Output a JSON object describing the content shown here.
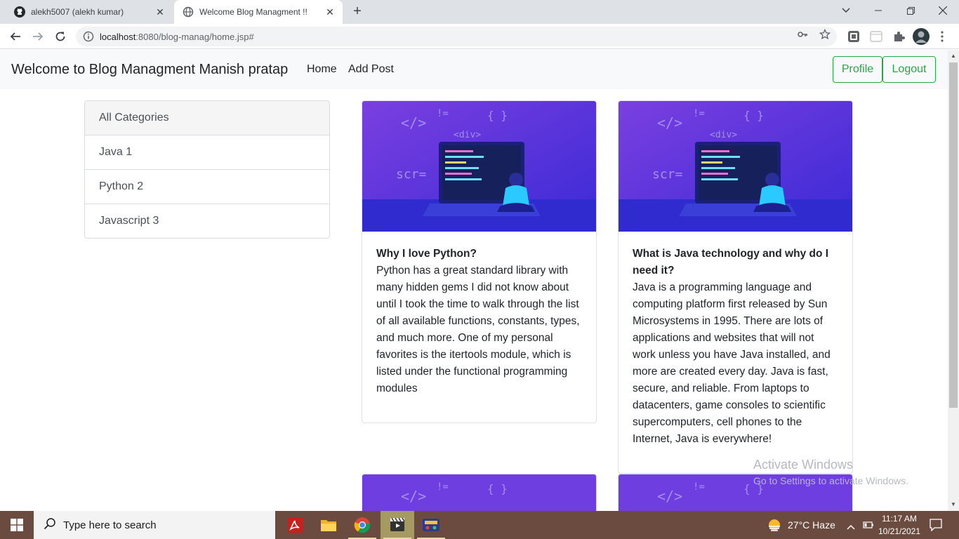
{
  "browser": {
    "tabs": [
      {
        "title": "alekh5007 (alekh kumar)",
        "active": false,
        "icon": "github-icon"
      },
      {
        "title": "Welcome Blog Managment !!",
        "active": true,
        "icon": "globe-icon"
      }
    ],
    "new_tab_label": "+",
    "url_host": "localhost",
    "url_path": ":8080/blog-manag/home.jsp#",
    "colors": {
      "tabstrip": "#dee1e6",
      "omnibox": "#f1f3f4"
    }
  },
  "page": {
    "brand": "Welcome to Blog Managment Manish pratap",
    "nav_links": [
      "Home",
      "Add Post"
    ],
    "profile_button": "Profile",
    "logout_button": "Logout",
    "categories": [
      "All Categories",
      "Java 1",
      "Python 2",
      "Javascript 3"
    ],
    "posts": [
      {
        "title": "Why I love Python?",
        "content": "Python has a great standard library with many hidden gems I did not know about until I took the time to walk through the list of all available functions, constants, types, and much more. One of my personal favorites is the itertools module, which is listed under the functional programming modules"
      },
      {
        "title": "What is Java technology and why do I need it?",
        "content": "Java is a programming language and computing platform first released by Sun Microsystems in 1995. There are lots of applications and websites that will not work unless you have Java installed, and more are created every day. Java is fast, secure, and reliable. From laptops to datacenters, game consoles to scientific supercomputers, cell phones to the Internet, Java is everywhere!"
      }
    ],
    "card_image_labels": [
      "</>",
      "{ }",
      "<div>",
      "scr=",
      "!="
    ],
    "colors": {
      "accent": "#28a745",
      "navbar": "#f8f9fa"
    }
  },
  "watermark": {
    "line1": "Activate Windows",
    "line2": "Go to Settings to activate Windows."
  },
  "taskbar": {
    "search_placeholder": "Type here to search",
    "weather": "27°C  Haze",
    "time": "11:17 AM",
    "date": "10/21/2021",
    "apps": [
      "acrobat-icon",
      "file-explorer-icon",
      "chrome-icon",
      "video-app-icon",
      "game-app-icon"
    ],
    "colors": {
      "bar": "#6b4b3f",
      "active_app": "#a69a63"
    }
  }
}
